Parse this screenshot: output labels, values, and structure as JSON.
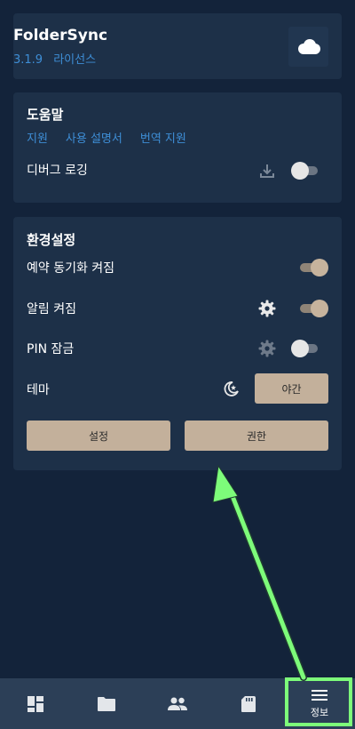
{
  "app": {
    "name": "FolderSync",
    "version": "3.1.9",
    "license_label": "라이선스"
  },
  "help": {
    "title": "도움말",
    "links": [
      "지원",
      "사용 설명서",
      "번역 지원"
    ],
    "debug_logging_label": "디버그 로깅",
    "debug_logging_on": false
  },
  "settings": {
    "title": "환경설정",
    "scheduled_sync_label": "예약 동기화 켜짐",
    "scheduled_sync_on": true,
    "notifications_label": "알림 켜짐",
    "notifications_on": true,
    "pin_lock_label": "PIN 잠금",
    "pin_lock_on": false,
    "theme_label": "테마",
    "theme_value": "야간",
    "settings_button": "설정",
    "permissions_button": "권한"
  },
  "bottom_nav": {
    "items": [
      {
        "icon": "dashboard-icon"
      },
      {
        "icon": "folder-icon"
      },
      {
        "icon": "accounts-icon"
      },
      {
        "icon": "sd-card-icon"
      },
      {
        "icon": "menu-icon",
        "label": "정보",
        "active": true
      }
    ]
  },
  "colors": {
    "background": "#13233a",
    "card": "#1d3048",
    "link": "#3e8ed6",
    "accent": "#c3b09b",
    "highlight": "#7dfc7a"
  }
}
